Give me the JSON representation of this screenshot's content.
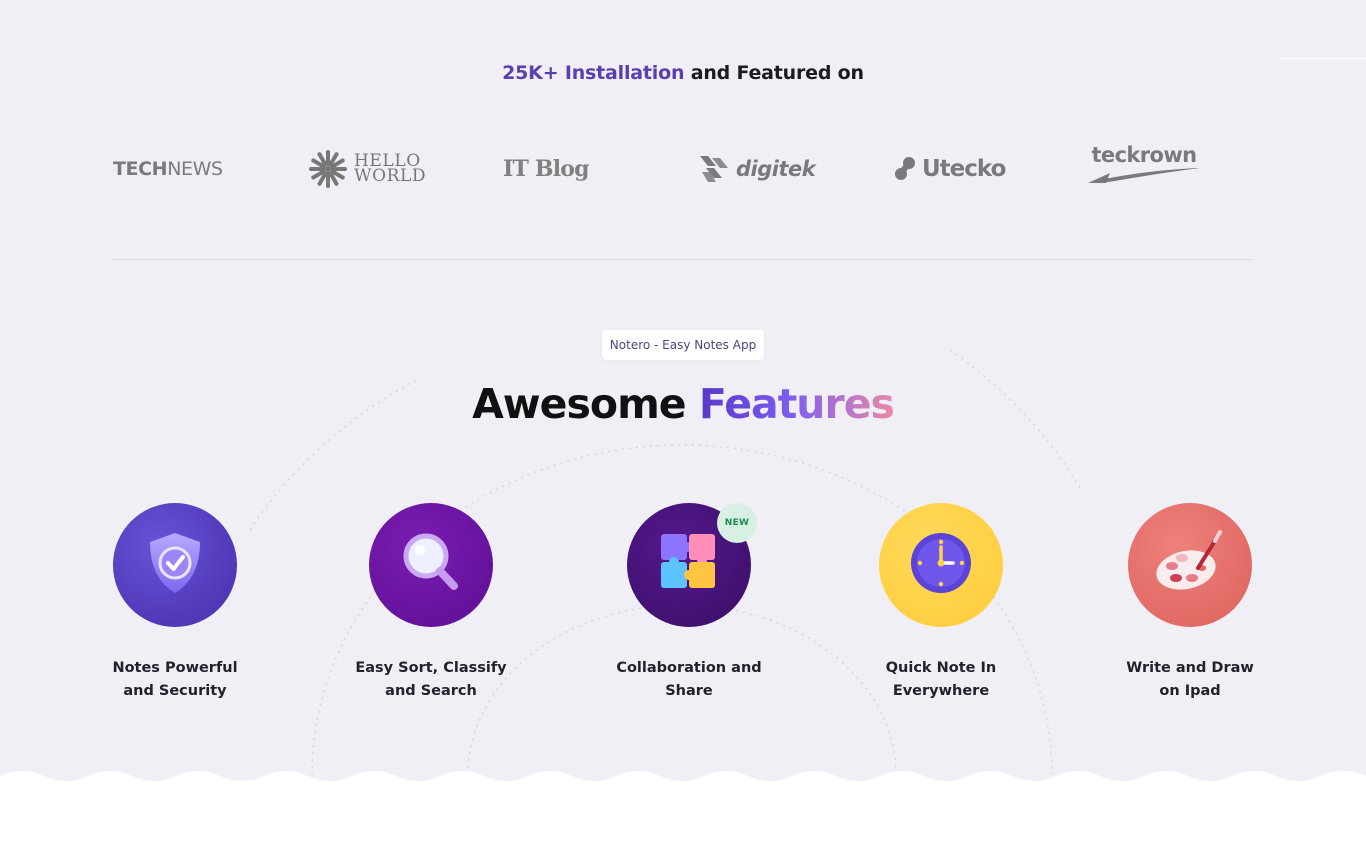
{
  "featured": {
    "headline_accent": "25K+ Installation",
    "headline_rest": " and Featured on",
    "logos": [
      {
        "name": "technews",
        "bold": "TECH",
        "light": "NEWS"
      },
      {
        "name": "hello-world",
        "line1": "HELLO",
        "line2": "WORLD"
      },
      {
        "name": "it-blog",
        "text": "IT Blog"
      },
      {
        "name": "digitek",
        "text": "digitek"
      },
      {
        "name": "utecko",
        "text": "Utecko"
      },
      {
        "name": "teckrown",
        "text": "teckrown"
      }
    ]
  },
  "features_section": {
    "badge": "Notero - Easy Notes App",
    "title_plain": "Awesome ",
    "title_accent": "Features",
    "items": [
      {
        "label": "Notes Powerful\nand Security",
        "icon": "shield-check-icon",
        "color": "#5a3fc4"
      },
      {
        "label": "Easy Sort, Classify\nand Search",
        "icon": "magnifier-icon",
        "color": "#6a149f"
      },
      {
        "label": "Collaboration and\nShare",
        "icon": "puzzle-icon",
        "color": "#47137a",
        "badge": "NEW"
      },
      {
        "label": "Quick Note In\nEverywhere",
        "icon": "clock-icon",
        "color": "#ffd24a"
      },
      {
        "label": "Write and Draw\non Ipad",
        "icon": "paint-palette-icon",
        "color": "#e8736e"
      }
    ]
  },
  "colors": {
    "accent": "#5a3fb0",
    "background": "#f0eff5",
    "new_badge_bg": "#d8efe3",
    "new_badge_text": "#1f8a55"
  }
}
